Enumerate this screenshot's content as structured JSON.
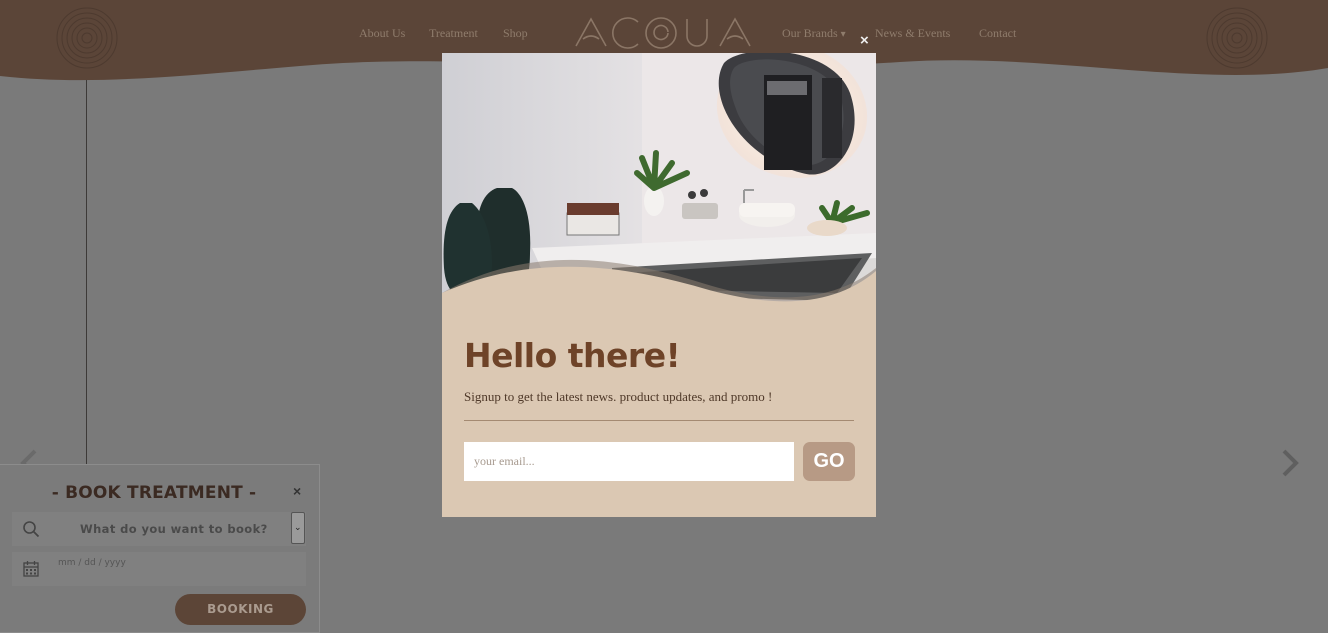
{
  "nav": {
    "left": [
      "About Us",
      "Treatment",
      "Shop"
    ],
    "right": [
      "Our Brands",
      "News & Events",
      "Contact"
    ],
    "dropdown_indicator": "▾"
  },
  "brand": {
    "logo_alt": "ACQUA",
    "logo_icon": "acqua-logo"
  },
  "modal": {
    "close_glyph": "×",
    "heading": "Hello there!",
    "subtitle": "Signup to get the latest news. product updates, and promo !",
    "email_placeholder": "your email...",
    "submit_label": "GO"
  },
  "booking": {
    "title": "- BOOK TREATMENT -",
    "close_glyph": "×",
    "select_placeholder": "What do you want to book?",
    "date_placeholder": "mm / dd / yyyy",
    "submit_label": "BOOKING",
    "search_icon": "search-icon",
    "calendar_icon": "calendar-icon"
  },
  "slider": {
    "prev_icon": "chevron-left-icon",
    "next_icon": "chevron-right-icon"
  },
  "colors": {
    "header_brown": "#5b4538",
    "modal_bg": "#dbc8b3",
    "heading_brown": "#6e4328",
    "go_button": "#b79a85",
    "overlay": "#7a7a7a"
  }
}
